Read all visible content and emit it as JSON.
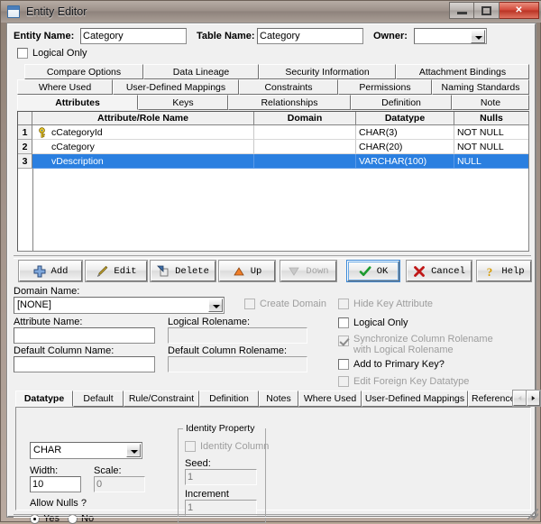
{
  "window": {
    "title": "Entity Editor",
    "icon": "window-icon",
    "buttons": {
      "minimize": "–",
      "maximize": "□",
      "close": "✕"
    }
  },
  "header": {
    "entity_name_label": "Entity Name:",
    "entity_name_value": "Category",
    "table_name_label": "Table Name:",
    "table_name_value": "Category",
    "owner_label": "Owner:",
    "owner_value": "",
    "logical_only_label": "Logical Only",
    "logical_only_checked": false
  },
  "tabs_row1": [
    {
      "label": "Compare Options"
    },
    {
      "label": "Data Lineage"
    },
    {
      "label": "Security Information"
    },
    {
      "label": "Attachment Bindings"
    }
  ],
  "tabs_row2": [
    {
      "label": "Where Used"
    },
    {
      "label": "User-Defined Mappings"
    },
    {
      "label": "Constraints"
    },
    {
      "label": "Permissions"
    },
    {
      "label": "Naming Standards"
    }
  ],
  "tabs_row3": [
    {
      "label": "Attributes",
      "selected": true
    },
    {
      "label": "Keys",
      "selected": false
    },
    {
      "label": "Relationships",
      "selected": false
    },
    {
      "label": "Definition",
      "selected": false
    },
    {
      "label": "Note",
      "selected": false
    }
  ],
  "grid": {
    "columns": [
      "",
      "Attribute/Role Name",
      "Domain",
      "Datatype",
      "Nulls"
    ],
    "rows": [
      {
        "num": "1",
        "key": true,
        "name": "cCategoryId",
        "domain": "",
        "datatype": "CHAR(3)",
        "nulls": "NOT NULL",
        "selected": false
      },
      {
        "num": "2",
        "key": false,
        "name": "cCategory",
        "domain": "",
        "datatype": "CHAR(20)",
        "nulls": "NOT NULL",
        "selected": false
      },
      {
        "num": "3",
        "key": false,
        "name": "vDescription",
        "domain": "",
        "datatype": "VARCHAR(100)",
        "nulls": "NULL",
        "selected": true
      }
    ]
  },
  "toolbar": {
    "add": "Add",
    "edit": "Edit",
    "delete": "Delete",
    "up": "Up",
    "down": "Down",
    "ok": "OK",
    "cancel": "Cancel",
    "help": "Help"
  },
  "form": {
    "domain_name_label": "Domain Name:",
    "domain_name_value": "[NONE]",
    "create_domain_label": "Create Domain",
    "create_domain_checked": false,
    "hide_key_attribute_label": "Hide Key Attribute",
    "hide_key_attribute_checked": false,
    "attribute_name_label": "Attribute Name:",
    "attribute_name_value": "",
    "logical_rolename_label": "Logical Rolename:",
    "logical_rolename_value": "",
    "default_column_name_label": "Default Column Name:",
    "default_column_name_value": "",
    "default_column_rolename_label": "Default Column Rolename:",
    "default_column_rolename_value": "",
    "logical_only_label": "Logical Only",
    "logical_only_checked": false,
    "sync_rolename_line1": "Synchronize Column Rolename",
    "sync_rolename_line2": "with Logical Rolename",
    "sync_rolename_checked": true,
    "add_to_primary_key_label": "Add to Primary Key?",
    "add_to_primary_key_checked": false,
    "edit_fk_datatype_label": "Edit Foreign Key Datatype",
    "edit_fk_datatype_checked": false
  },
  "bottom_tabs": [
    {
      "label": "Datatype",
      "selected": true
    },
    {
      "label": "Default",
      "selected": false
    },
    {
      "label": "Rule/Constraint",
      "selected": false
    },
    {
      "label": "Definition",
      "selected": false
    },
    {
      "label": "Notes",
      "selected": false
    },
    {
      "label": "Where Used",
      "selected": false
    },
    {
      "label": "User-Defined Mappings",
      "selected": false
    },
    {
      "label": "Reference Values",
      "selected": false
    }
  ],
  "bottom_tab_scroll": {
    "left": "◄",
    "right": "►"
  },
  "datatype_panel": {
    "datatype_value": "CHAR",
    "width_label": "Width:",
    "width_value": "10",
    "scale_label": "Scale:",
    "scale_value": "0",
    "allow_nulls_label": "Allow Nulls ?",
    "allow_nulls_yes": "Yes",
    "allow_nulls_no": "No",
    "allow_nulls_selected": "Yes",
    "identity_property_label": "Identity Property",
    "identity_column_label": "Identity Column",
    "identity_column_checked": false,
    "seed_label": "Seed:",
    "seed_value": "1",
    "increment_label": "Increment",
    "increment_value": "1"
  },
  "colors": {
    "selection": "#2a7fe0",
    "accent": "#3d8ad8",
    "key_icon": "#e8c000"
  }
}
